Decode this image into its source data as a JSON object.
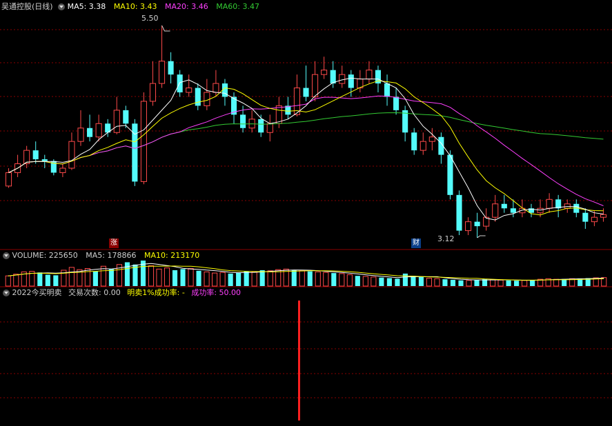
{
  "panel1": {
    "title": "吴通控股(日线)",
    "ma5_label": "MA5: 3.38",
    "ma10_label": "MA10: 3.43",
    "ma20_label": "MA20: 3.46",
    "ma60_label": "MA60: 3.47",
    "high_label": "5.50",
    "low_label": "3.12",
    "zhang_label": "涨",
    "cai_label": "财"
  },
  "panel2": {
    "volume_label": "VOLUME: 225650",
    "ma5_label": "MA5: 178866",
    "ma10_label": "MA10: 213170"
  },
  "panel3": {
    "title": "2022今买明卖",
    "trades_label": "交易次数: 0.00",
    "sell_label": "明卖1%成功率: -",
    "rate_label": "成功率: 50.00"
  },
  "colors": {
    "up": "#ff4a4a",
    "down": "#54fcfc",
    "ma5": "#ffffff",
    "ma10": "#ffff00",
    "ma20": "#ff40ff",
    "ma60": "#33cc33",
    "grid": "#8b0000",
    "signal": "#ff2020"
  },
  "chart_data": [
    {
      "type": "candlestick",
      "ylim": [
        3.05,
        5.6
      ],
      "high_marker": 5.5,
      "low_marker": 3.12,
      "candles": [
        [
          3.7,
          3.85,
          3.9,
          3.68
        ],
        [
          3.85,
          3.95,
          4.05,
          3.8
        ],
        [
          3.95,
          4.1,
          4.15,
          3.9
        ],
        [
          4.1,
          4.0,
          4.2,
          3.95
        ],
        [
          4.0,
          3.98,
          4.05,
          3.9
        ],
        [
          3.98,
          3.85,
          4.0,
          3.82
        ],
        [
          3.85,
          3.9,
          3.95,
          3.8
        ],
        [
          3.9,
          4.2,
          4.3,
          3.88
        ],
        [
          4.2,
          4.35,
          4.55,
          4.15
        ],
        [
          4.35,
          4.25,
          4.5,
          4.2
        ],
        [
          4.25,
          4.4,
          4.5,
          4.2
        ],
        [
          4.4,
          4.3,
          4.45,
          4.25
        ],
        [
          4.3,
          4.55,
          4.7,
          4.28
        ],
        [
          4.55,
          4.4,
          4.6,
          4.35
        ],
        [
          4.4,
          3.75,
          4.45,
          3.7
        ],
        [
          3.75,
          4.65,
          4.75,
          3.72
        ],
        [
          4.65,
          4.85,
          5.1,
          4.6
        ],
        [
          4.85,
          5.1,
          5.5,
          4.8
        ],
        [
          5.1,
          4.95,
          5.2,
          4.85
        ],
        [
          4.95,
          4.75,
          5.0,
          4.7
        ],
        [
          4.75,
          4.8,
          4.95,
          4.7
        ],
        [
          4.8,
          4.6,
          4.85,
          4.55
        ],
        [
          4.6,
          4.75,
          4.9,
          4.55
        ],
        [
          4.75,
          4.85,
          5.0,
          4.7
        ],
        [
          4.85,
          4.7,
          4.9,
          4.6
        ],
        [
          4.7,
          4.5,
          4.75,
          4.4
        ],
        [
          4.5,
          4.35,
          4.6,
          4.3
        ],
        [
          4.35,
          4.45,
          4.55,
          4.3
        ],
        [
          4.45,
          4.3,
          4.5,
          4.25
        ],
        [
          4.3,
          4.4,
          4.5,
          4.2
        ],
        [
          4.4,
          4.6,
          4.7,
          4.35
        ],
        [
          4.6,
          4.5,
          4.7,
          4.45
        ],
        [
          4.5,
          4.8,
          4.95,
          4.48
        ],
        [
          4.8,
          4.7,
          5.05,
          4.65
        ],
        [
          4.7,
          4.95,
          5.1,
          4.65
        ],
        [
          4.95,
          5.0,
          5.15,
          4.9
        ],
        [
          5.0,
          4.85,
          5.1,
          4.8
        ],
        [
          4.85,
          4.95,
          5.05,
          4.8
        ],
        [
          4.95,
          4.8,
          5.0,
          4.7
        ],
        [
          4.8,
          4.9,
          5.0,
          4.75
        ],
        [
          4.9,
          5.0,
          5.1,
          4.85
        ],
        [
          5.0,
          4.85,
          5.05,
          4.75
        ],
        [
          4.85,
          4.7,
          4.95,
          4.6
        ],
        [
          4.7,
          4.55,
          4.8,
          4.5
        ],
        [
          4.55,
          4.3,
          4.6,
          4.2
        ],
        [
          4.3,
          4.1,
          4.35,
          4.05
        ],
        [
          4.1,
          4.2,
          4.3,
          4.05
        ],
        [
          4.2,
          4.25,
          4.35,
          4.1
        ],
        [
          4.25,
          4.05,
          4.3,
          3.95
        ],
        [
          4.05,
          3.6,
          4.1,
          3.55
        ],
        [
          3.6,
          3.2,
          3.65,
          3.15
        ],
        [
          3.2,
          3.3,
          3.35,
          3.15
        ],
        [
          3.3,
          3.25,
          3.4,
          3.12
        ],
        [
          3.25,
          3.35,
          3.45,
          3.2
        ],
        [
          3.35,
          3.5,
          3.6,
          3.3
        ],
        [
          3.5,
          3.45,
          3.6,
          3.4
        ],
        [
          3.45,
          3.4,
          3.55,
          3.35
        ],
        [
          3.4,
          3.45,
          3.55,
          3.35
        ],
        [
          3.45,
          3.4,
          3.5,
          3.35
        ],
        [
          3.4,
          3.45,
          3.55,
          3.35
        ],
        [
          3.45,
          3.55,
          3.62,
          3.4
        ],
        [
          3.55,
          3.45,
          3.6,
          3.35
        ],
        [
          3.45,
          3.5,
          3.55,
          3.4
        ],
        [
          3.5,
          3.4,
          3.55,
          3.35
        ],
        [
          3.4,
          3.3,
          3.45,
          3.22
        ],
        [
          3.3,
          3.35,
          3.42,
          3.25
        ],
        [
          3.35,
          3.38,
          3.45,
          3.3
        ]
      ]
    },
    {
      "type": "bar",
      "title": "VOLUME",
      "values": [
        180,
        210,
        250,
        260,
        240,
        200,
        190,
        280,
        330,
        290,
        310,
        260,
        350,
        300,
        380,
        420,
        380,
        450,
        360,
        300,
        320,
        280,
        300,
        310,
        270,
        250,
        230,
        240,
        220,
        240,
        260,
        250,
        280,
        270,
        290,
        300,
        280,
        270,
        260,
        250,
        240,
        230,
        220,
        200,
        180,
        170,
        160,
        150,
        140,
        130,
        220,
        180,
        160,
        140,
        130,
        120,
        110,
        100,
        100,
        110,
        120,
        110,
        105,
        100,
        95,
        100,
        110,
        120,
        130,
        120,
        125,
        130,
        135,
        140,
        145,
        150
      ]
    }
  ]
}
